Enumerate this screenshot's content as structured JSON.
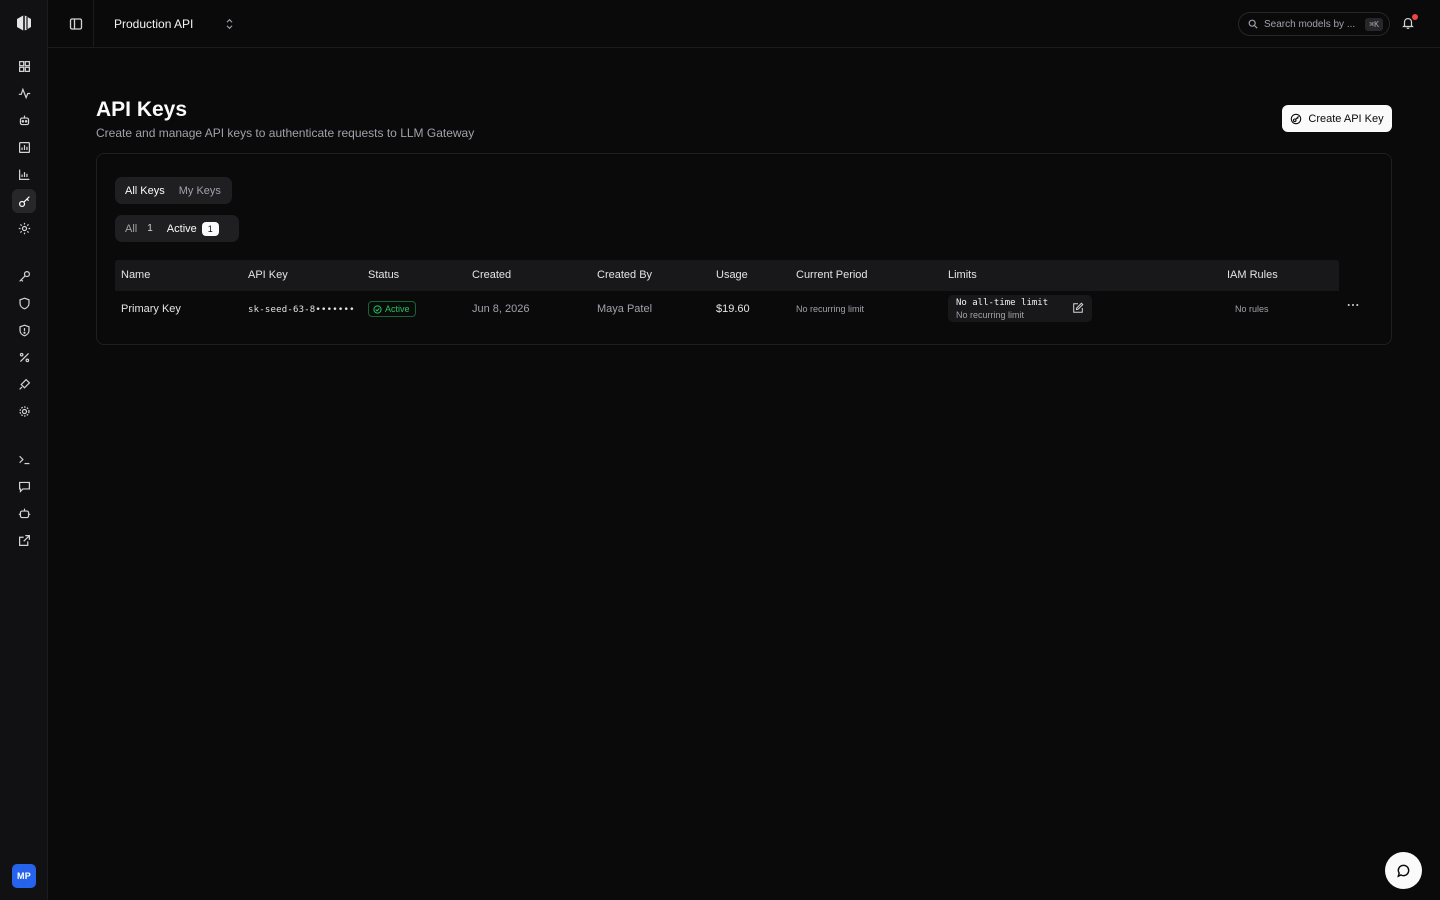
{
  "project": {
    "name": "Production API"
  },
  "search": {
    "placeholder": "Search models by ...",
    "shortcut": "⌘K"
  },
  "user": {
    "initials": "MP"
  },
  "header": {
    "title": "API Keys",
    "subtitle": "Create and manage API keys to authenticate requests to LLM Gateway",
    "create_label": "Create API Key"
  },
  "scope_tabs": [
    "All Keys",
    "My Keys"
  ],
  "filter_tabs": [
    {
      "label": "All",
      "count": "1"
    },
    {
      "label": "Active",
      "count": "1"
    }
  ],
  "table": {
    "columns": [
      "Name",
      "API Key",
      "Status",
      "Created",
      "Created By",
      "Usage",
      "Current Period",
      "Limits",
      "IAM Rules"
    ],
    "rows": [
      {
        "name": "Primary Key",
        "api_key": "sk-seed-63-8•••••••",
        "status": "Active",
        "created": "Jun 8, 2026",
        "created_by": "Maya Patel",
        "usage": "$19.60",
        "current_period": "No recurring limit",
        "limits_primary": "No all-time limit",
        "limits_secondary": "No recurring limit",
        "iam_rules": "No rules"
      }
    ]
  },
  "colors": {
    "background": "#0a0a0b",
    "sidebar": "#111113",
    "accent_active": "#22c55e",
    "avatar": "#2563eb",
    "notification": "#ef4444"
  }
}
